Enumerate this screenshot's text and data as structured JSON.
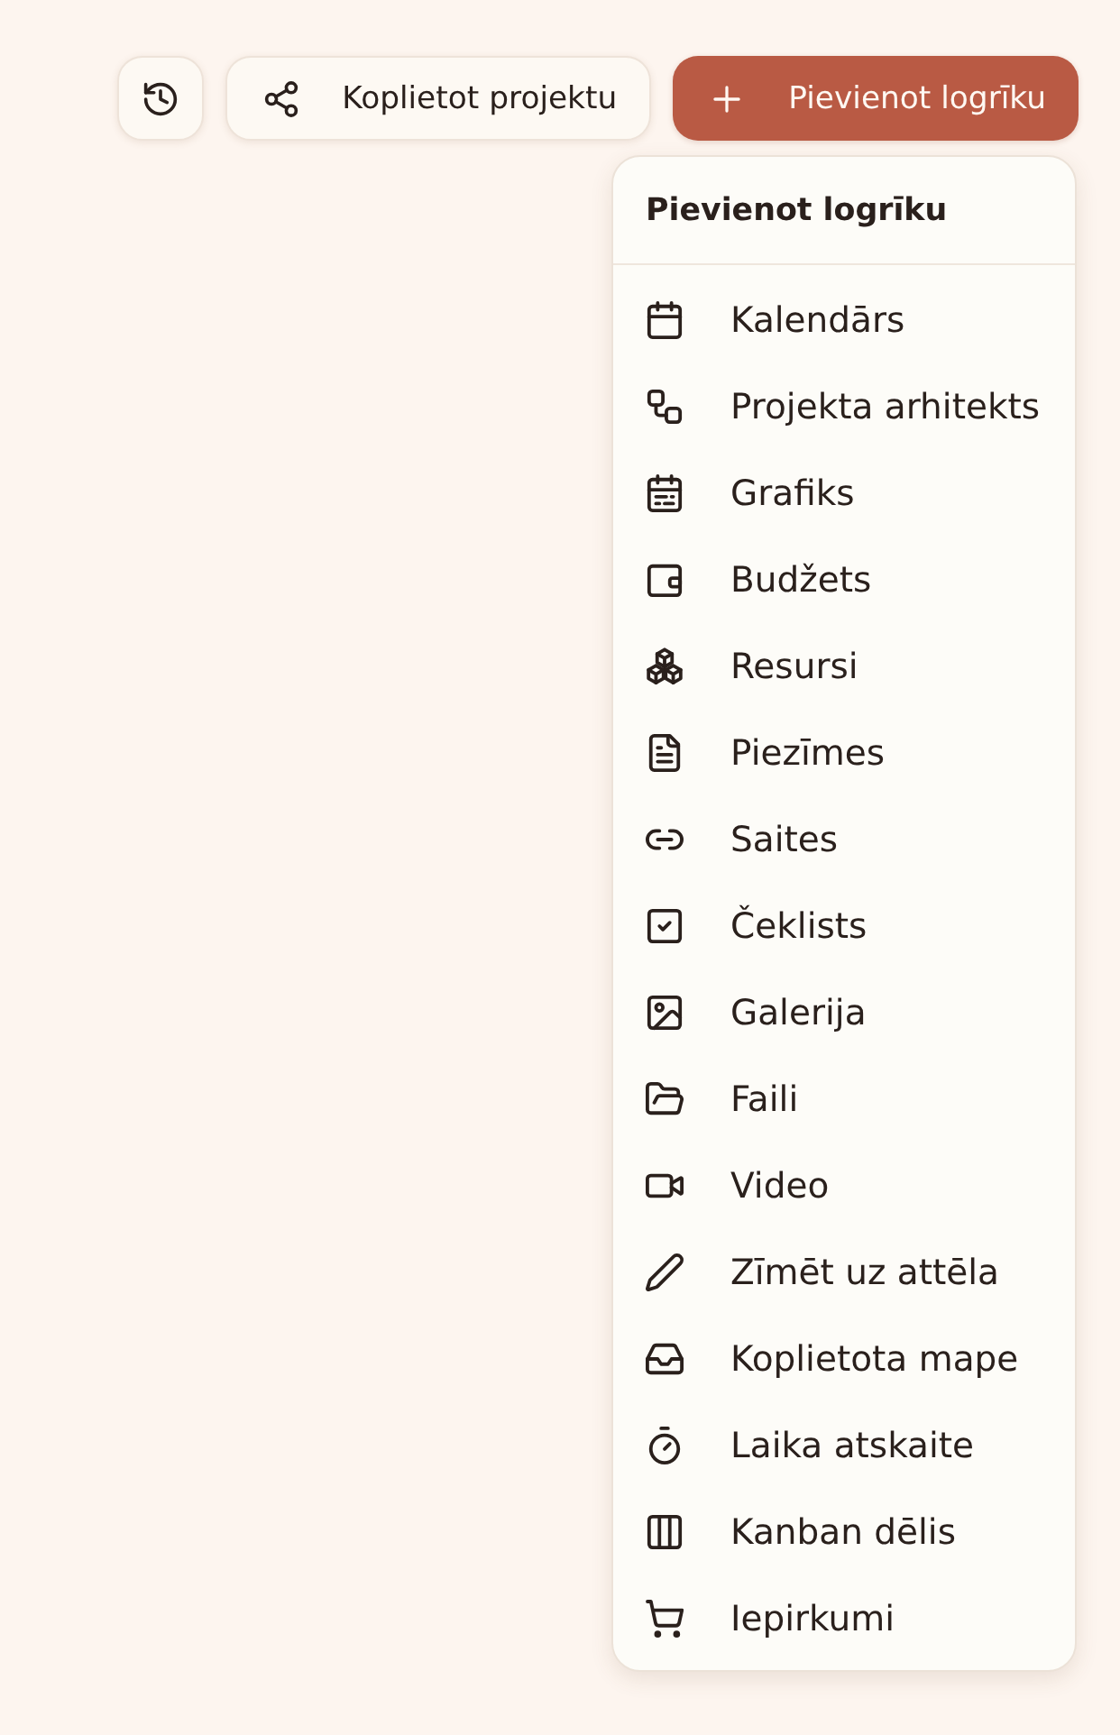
{
  "toolbar": {
    "buttons": [
      {
        "kind": "history"
      },
      {
        "kind": "share",
        "label": "Koplietot projektu"
      },
      {
        "kind": "add",
        "label": "Pievienot logrīku"
      }
    ]
  },
  "menu": {
    "title": "Pievienot logrīku",
    "items": [
      {
        "label": "Kalendārs"
      },
      {
        "label": "Projekta arhitekts"
      },
      {
        "label": "Grafiks"
      },
      {
        "label": "Budžets"
      },
      {
        "label": "Resursi"
      },
      {
        "label": "Piezīmes"
      },
      {
        "label": "Saites"
      },
      {
        "label": "Čeklists"
      },
      {
        "label": "Galerija"
      },
      {
        "label": "Faili"
      },
      {
        "label": "Video"
      },
      {
        "label": "Zīmēt uz attēla"
      },
      {
        "label": "Koplietota mape"
      },
      {
        "label": "Laika atskaite"
      },
      {
        "label": "Kanban dēlis"
      },
      {
        "label": "Iepirkumi"
      }
    ]
  }
}
